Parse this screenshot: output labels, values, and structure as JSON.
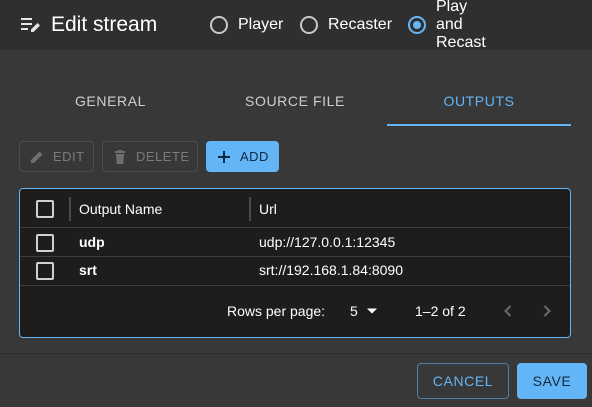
{
  "header": {
    "title": "Edit stream",
    "modes": [
      {
        "label": "Player",
        "checked": false
      },
      {
        "label": "Recaster",
        "checked": false
      },
      {
        "label": "Play and Recast",
        "checked": true
      }
    ]
  },
  "tabs": [
    {
      "label": "GENERAL",
      "active": false
    },
    {
      "label": "SOURCE FILE",
      "active": false
    },
    {
      "label": "OUTPUTS",
      "active": true
    }
  ],
  "toolbar": {
    "edit_label": "EDIT",
    "delete_label": "DELETE",
    "add_label": "ADD"
  },
  "table": {
    "columns": [
      "Output Name",
      "Url"
    ],
    "rows": [
      {
        "name": "udp",
        "url": "udp://127.0.0.1:12345"
      },
      {
        "name": "srt",
        "url": "srt://192.168.1.84:8090"
      }
    ],
    "footer": {
      "rows_per_page_label": "Rows per page:",
      "rows_per_page_value": "5",
      "range": "1–2 of 2"
    }
  },
  "actions": {
    "cancel_label": "CANCEL",
    "save_label": "SAVE"
  },
  "colors": {
    "accent": "#64b5f6",
    "background": "#383838",
    "table_background": "#1d1d1d"
  }
}
